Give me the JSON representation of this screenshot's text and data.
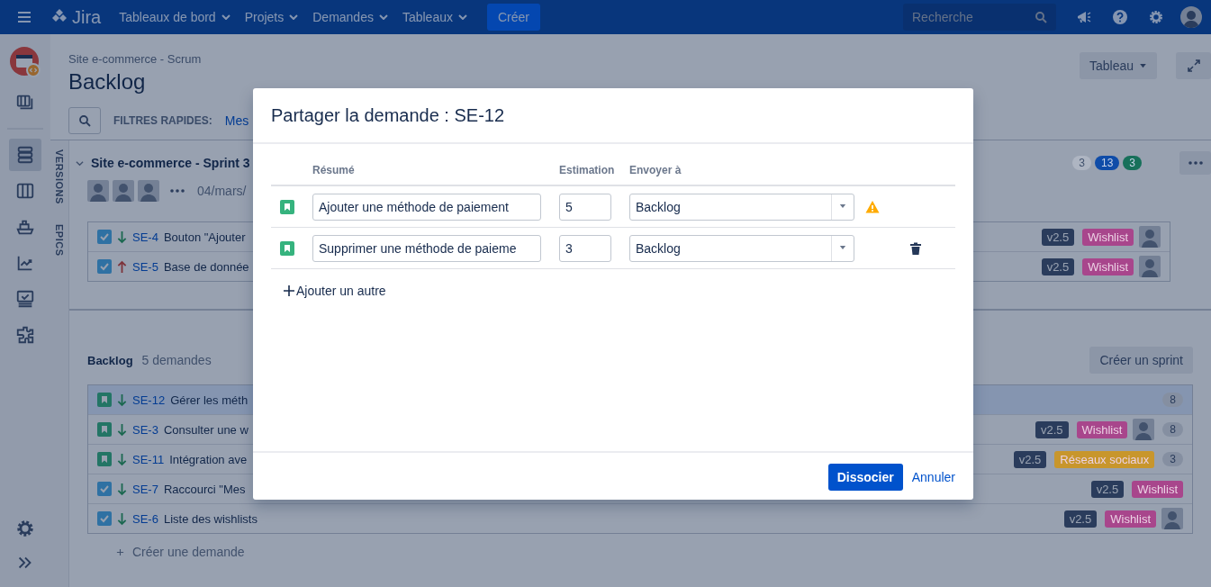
{
  "topbar": {
    "product": "Jira",
    "menus": [
      {
        "label": "Tableaux de bord"
      },
      {
        "label": "Projets"
      },
      {
        "label": "Demandes"
      },
      {
        "label": "Tableaux"
      }
    ],
    "create_button": "Créer",
    "search": {
      "placeholder": "Recherche"
    }
  },
  "sidebar": {
    "items": [
      {
        "kind": "boards",
        "selected": false
      },
      {
        "kind": "divider"
      },
      {
        "kind": "backlog",
        "selected": true
      },
      {
        "kind": "columns",
        "selected": false
      },
      {
        "kind": "releases",
        "selected": false
      },
      {
        "kind": "reports",
        "selected": false
      },
      {
        "kind": "monitor",
        "selected": false
      },
      {
        "kind": "addons",
        "selected": false
      }
    ]
  },
  "side_tabs": [
    "VERSIONS",
    "EPICS"
  ],
  "header": {
    "breadcrumb": "Site e-commerce - Scrum",
    "title": "Backlog",
    "quick_filters_label": "FILTRES RAPIDES:",
    "quick_filter": "Mes",
    "board_button": "Tableau"
  },
  "sprint": {
    "name": "Site e-commerce - Sprint 3",
    "expanded": true,
    "avatars": [
      {
        "kind": "photo"
      },
      {
        "kind": "photo"
      },
      {
        "kind": "photo"
      }
    ],
    "date": "04/mars/",
    "counts": [
      {
        "value": "3",
        "color": "#aeb5c2"
      },
      {
        "value": "13",
        "color": "#0f4ca8"
      },
      {
        "value": "3",
        "color": "#17705a"
      }
    ],
    "issues": [
      {
        "kind": "task",
        "priority_high": false,
        "key": "SE-4",
        "summary": "Bouton \"Ajouter",
        "selected": false,
        "version": "v2.5",
        "epic": {
          "label": "Wishlist",
          "color": "#a8468c"
        },
        "avatar": true
      },
      {
        "kind": "task",
        "priority_high": true,
        "key": "SE-5",
        "summary": "Base de donnée",
        "selected": false,
        "version": "v2.5",
        "epic": {
          "label": "Wishlist",
          "color": "#a8468c"
        },
        "avatar": true
      }
    ]
  },
  "backlog": {
    "title": "Backlog",
    "count": "5 demandes",
    "create_sprint": "Créer un sprint",
    "create_issue": "Créer une demande",
    "issues": [
      {
        "kind": "story",
        "priority_high": false,
        "key": "SE-12",
        "summary": "Gérer les méth",
        "selected": true,
        "avatar": false,
        "estimate": "8"
      },
      {
        "kind": "story",
        "priority_high": false,
        "key": "SE-3",
        "summary": "Consulter une w",
        "selected": false,
        "version": "v2.5",
        "epic": {
          "label": "Wishlist",
          "color": "#a8468c"
        },
        "avatar": true,
        "estimate": "8"
      },
      {
        "kind": "story",
        "priority_high": false,
        "key": "SE-11",
        "summary": "Intégration ave",
        "selected": false,
        "version": "v2.5",
        "epic": {
          "label": "Réseaux sociaux",
          "color": "#c8962c"
        },
        "avatar": false,
        "estimate": "3"
      },
      {
        "kind": "task",
        "priority_high": false,
        "key": "SE-7",
        "summary": "Raccourci \"Mes",
        "selected": false,
        "version": "v2.5",
        "epic": {
          "label": "Wishlist",
          "color": "#a8468c"
        },
        "avatar": false
      },
      {
        "kind": "task",
        "priority_high": false,
        "key": "SE-6",
        "summary": "Liste des wishlists",
        "selected": false,
        "version": "v2.5",
        "epic": {
          "label": "Wishlist",
          "color": "#a8468c"
        },
        "avatar": true
      }
    ]
  },
  "modal": {
    "title": "Partager la demande : SE-12",
    "columns": [
      "Résumé",
      "Estimation",
      "Envoyer à"
    ],
    "rows": [
      {
        "kind": "story",
        "summary": "Ajouter une méthode de paiement",
        "estimate": "5",
        "destination": "Backlog",
        "warning": true,
        "deletable": false
      },
      {
        "kind": "story",
        "summary": "Supprimer une méthode de paieme",
        "estimate": "3",
        "destination": "Backlog",
        "warning": false,
        "deletable": true
      }
    ],
    "add_link": "Ajouter un autre",
    "primary_button": "Dissocier",
    "cancel_link": "Annuler"
  }
}
